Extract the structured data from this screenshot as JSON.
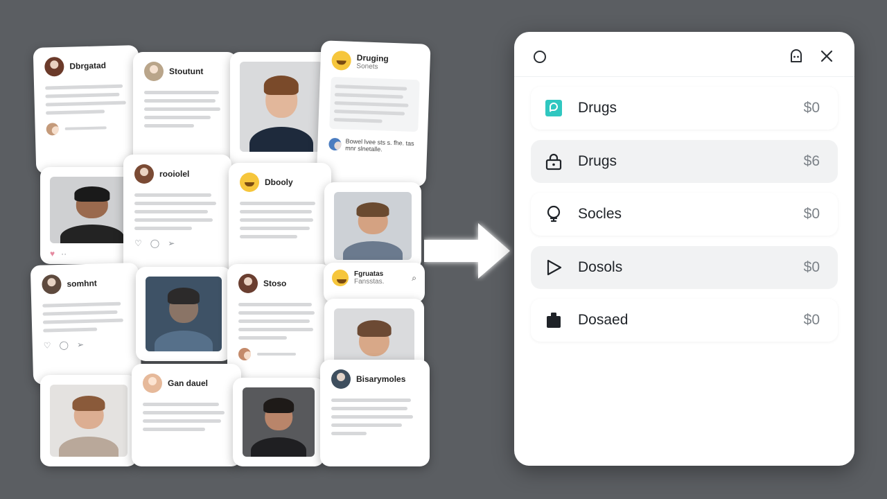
{
  "collage": {
    "cards": [
      {
        "name": "Dbrgatad",
        "sub": "",
        "footer": "",
        "kind": "text"
      },
      {
        "name": "Stoutunt",
        "sub": "",
        "kind": "text"
      },
      {
        "name": "Druging",
        "sub": "Sonets",
        "footer": "Bowel lvee sts s. fhe. tas mnr slnetalle.",
        "kind": "text"
      },
      {
        "name": "rooiolel",
        "kind": "text"
      },
      {
        "name": "Dbooly",
        "kind": "text"
      },
      {
        "name": "somhnt",
        "kind": "text"
      },
      {
        "name": "Stoso",
        "kind": "text"
      },
      {
        "name": "Fgruatas",
        "sub": "Fansstas.",
        "kind": "text"
      },
      {
        "name": "Gan dauel",
        "kind": "text"
      },
      {
        "name": "Bisarymoles",
        "kind": "text"
      }
    ]
  },
  "colors": {
    "background": "#5b5e62",
    "panel": "#ffffff",
    "accent_teal": "#2fc7c0",
    "text_dark": "#1f2328",
    "text_amount": "#7c8288"
  },
  "panel": {
    "header": {
      "left_icon": "circle-icon",
      "right_icons": [
        "ghost-icon",
        "close-icon"
      ]
    },
    "items": [
      {
        "label": "Drugs",
        "amount": "$0",
        "icon": "chat-bubble-icon",
        "highlight": false
      },
      {
        "label": "Drugs",
        "amount": "$6",
        "icon": "lock-icon",
        "highlight": true
      },
      {
        "label": "Socles",
        "amount": "$0",
        "icon": "lightbulb-icon",
        "highlight": false
      },
      {
        "label": "Dosols",
        "amount": "$0",
        "icon": "play-icon",
        "highlight": true
      },
      {
        "label": "Dosaed",
        "amount": "$0",
        "icon": "bag-icon",
        "highlight": false
      }
    ]
  }
}
